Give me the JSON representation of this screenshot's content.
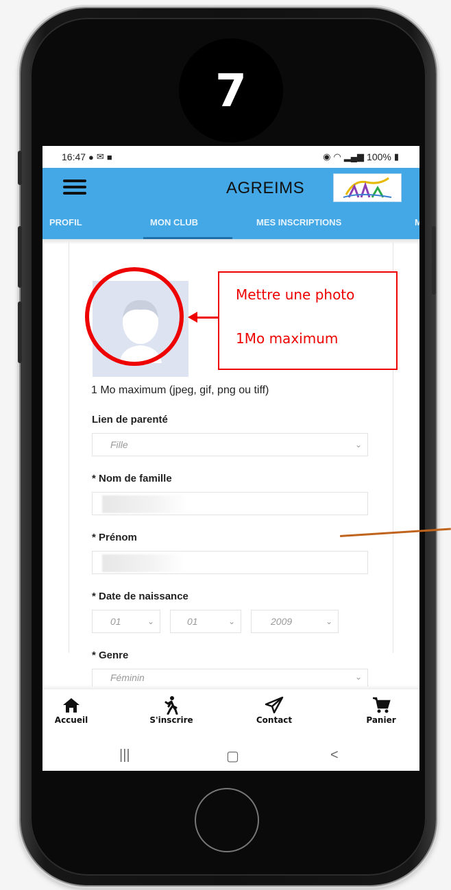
{
  "step_number": "7",
  "status_bar": {
    "time": "16:47",
    "battery": "100%"
  },
  "app": {
    "title": "AGREIMS",
    "accent": "#44a8e6"
  },
  "tabs": [
    {
      "label": "PROFIL"
    },
    {
      "label": "MON CLUB",
      "active": true
    },
    {
      "label": "MES INSCRIPTIONS"
    },
    {
      "label": "M"
    }
  ],
  "form": {
    "photo_help": "1 Mo maximum (jpeg, gif, png ou tiff)",
    "parent_link": {
      "label": "Lien de parenté",
      "value": "Fille"
    },
    "last_name": {
      "label": "* Nom de famille"
    },
    "first_name": {
      "label": "* Prénom"
    },
    "birth_date": {
      "label": "* Date de naissance",
      "day": "01",
      "month": "01",
      "year": "2009"
    },
    "gender": {
      "label": "* Genre",
      "value": "Féminin"
    }
  },
  "bottom_nav": [
    {
      "label": "Accueil",
      "icon": "home-icon"
    },
    {
      "label": "S'inscrire",
      "icon": "walking-person-icon"
    },
    {
      "label": "Contact",
      "icon": "paper-plane-icon"
    },
    {
      "label": "Panier",
      "icon": "cart-icon"
    }
  ],
  "annotation": {
    "line1": "Mettre une photo",
    "line2": "1Mo maximum",
    "color": "#ee0000"
  }
}
